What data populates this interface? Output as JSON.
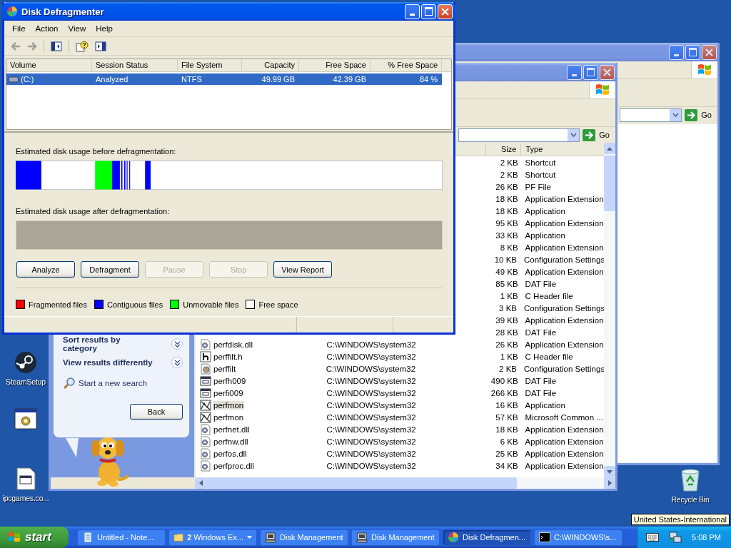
{
  "defragmenter": {
    "title": "Disk Defragmenter",
    "menu": [
      "File",
      "Action",
      "View",
      "Help"
    ],
    "volume_columns": [
      "Volume",
      "Session Status",
      "File System",
      "Capacity",
      "Free Space",
      "% Free Space"
    ],
    "volumes": [
      {
        "volume": "(C:)",
        "session_status": "Analyzed",
        "file_system": "NTFS",
        "capacity": "49.99 GB",
        "free_space": "42.39 GB",
        "percent_free": "84 %",
        "selected": true
      }
    ],
    "before_label": "Estimated disk usage before defragmentation:",
    "after_label": "Estimated disk usage after defragmentation:",
    "buttons": [
      {
        "label": "Analyze",
        "disabled": false
      },
      {
        "label": "Defragment",
        "disabled": false
      },
      {
        "label": "Pause",
        "disabled": true
      },
      {
        "label": "Stop",
        "disabled": true
      },
      {
        "label": "View Report",
        "disabled": false
      }
    ],
    "legend": [
      {
        "label": "Fragmented files",
        "color": "#ff0000"
      },
      {
        "label": "Contiguous files",
        "color": "#0000ff"
      },
      {
        "label": "Unmovable files",
        "color": "#00ff00"
      },
      {
        "label": "Free space",
        "color": "#ffffff"
      }
    ]
  },
  "back_explorer": {
    "go_button": "Go"
  },
  "search_results": {
    "go_button": "Go",
    "columns": [
      "Size",
      "Type"
    ],
    "rows": [
      {
        "size": "2 KB",
        "type": "Shortcut",
        "selected": false
      },
      {
        "size": "2 KB",
        "type": "Shortcut",
        "selected": false
      },
      {
        "size": "26 KB",
        "type": "PF File",
        "selected": false
      },
      {
        "size": "18 KB",
        "type": "Application Extension",
        "selected": false
      },
      {
        "size": "18 KB",
        "type": "Application",
        "selected": false
      },
      {
        "size": "95 KB",
        "type": "Application Extension",
        "selected": false
      },
      {
        "size": "33 KB",
        "type": "Application",
        "selected": false
      },
      {
        "size": "8 KB",
        "type": "Application Extension",
        "selected": false
      },
      {
        "size": "10 KB",
        "type": "Configuration Settings",
        "selected": false
      },
      {
        "size": "49 KB",
        "type": "Application Extension",
        "selected": false
      },
      {
        "size": "85 KB",
        "type": "DAT File",
        "selected": false
      },
      {
        "size": "1 KB",
        "type": "C Header file",
        "selected": false
      },
      {
        "size": "3 KB",
        "type": "Configuration Settings",
        "selected": false
      },
      {
        "size": "39 KB",
        "type": "Application Extension",
        "selected": false
      },
      {
        "size": "28 KB",
        "type": "DAT File",
        "selected": false
      },
      {
        "name": "perfdisk.dll",
        "folder": "C:\\WINDOWS\\system32",
        "size": "26 KB",
        "type": "Application Extension",
        "kind": "dll",
        "selected": false
      },
      {
        "name": "perffilt.h",
        "folder": "C:\\WINDOWS\\system32",
        "size": "1 KB",
        "type": "C Header file",
        "kind": "header",
        "selected": false
      },
      {
        "name": "perffilt",
        "folder": "C:\\WINDOWS\\system32",
        "size": "2 KB",
        "type": "Configuration Settings",
        "kind": "config",
        "selected": false
      },
      {
        "name": "perfh009",
        "folder": "C:\\WINDOWS\\system32",
        "size": "490 KB",
        "type": "DAT File",
        "kind": "dat",
        "selected": false
      },
      {
        "name": "perfi009",
        "folder": "C:\\WINDOWS\\system32",
        "size": "266 KB",
        "type": "DAT File",
        "kind": "dat",
        "selected": false
      },
      {
        "name": "perfmon",
        "folder": "C:\\WINDOWS\\system32",
        "size": "16 KB",
        "type": "Application",
        "kind": "monitor",
        "selected": true
      },
      {
        "name": "perfmon",
        "folder": "C:\\WINDOWS\\system32",
        "size": "57 KB",
        "type": "Microsoft Common ...",
        "kind": "monitor",
        "selected": false
      },
      {
        "name": "perfnet.dll",
        "folder": "C:\\WINDOWS\\system32",
        "size": "18 KB",
        "type": "Application Extension",
        "kind": "dll",
        "selected": false
      },
      {
        "name": "perfnw.dll",
        "folder": "C:\\WINDOWS\\system32",
        "size": "6 KB",
        "type": "Application Extension",
        "kind": "dll",
        "selected": false
      },
      {
        "name": "perfos.dll",
        "folder": "C:\\WINDOWS\\system32",
        "size": "25 KB",
        "type": "Application Extension",
        "kind": "dll",
        "selected": false
      },
      {
        "name": "perfproc.dll",
        "folder": "C:\\WINDOWS\\system32",
        "size": "34 KB",
        "type": "Application Extension",
        "kind": "dll",
        "selected": false
      }
    ],
    "companion": {
      "options": [
        "Sort results by category",
        "View results differently"
      ],
      "new_search": "Start a new search",
      "back_button": "Back"
    }
  },
  "desktop": {
    "icons": [
      {
        "label": "SteamSetup",
        "kind": "steam"
      },
      {
        "kind": "program"
      },
      {
        "label": "ipcgames.co...",
        "kind": "file"
      },
      {
        "label": "Recycle Bin",
        "kind": "recycle"
      }
    ],
    "tooltip": "United States-International"
  },
  "taskbar": {
    "start": "start",
    "items": [
      {
        "label": "Untitled - Note...",
        "kind": "notepad",
        "selected": false,
        "grouped": false
      },
      {
        "label": "**2** Windows Ex...",
        "kind": "folder",
        "selected": false,
        "grouped": true
      },
      {
        "label": "Disk Management",
        "kind": "disk",
        "selected": false,
        "grouped": false
      },
      {
        "label": "Disk Management",
        "kind": "disk",
        "selected": false,
        "grouped": false
      },
      {
        "label": "Disk Defragmen...",
        "kind": "defrag",
        "selected": true,
        "grouped": false
      },
      {
        "label": "C:\\WINDOWS\\s...",
        "kind": "console",
        "selected": false,
        "grouped": false
      }
    ],
    "clock": "5:08 PM"
  }
}
